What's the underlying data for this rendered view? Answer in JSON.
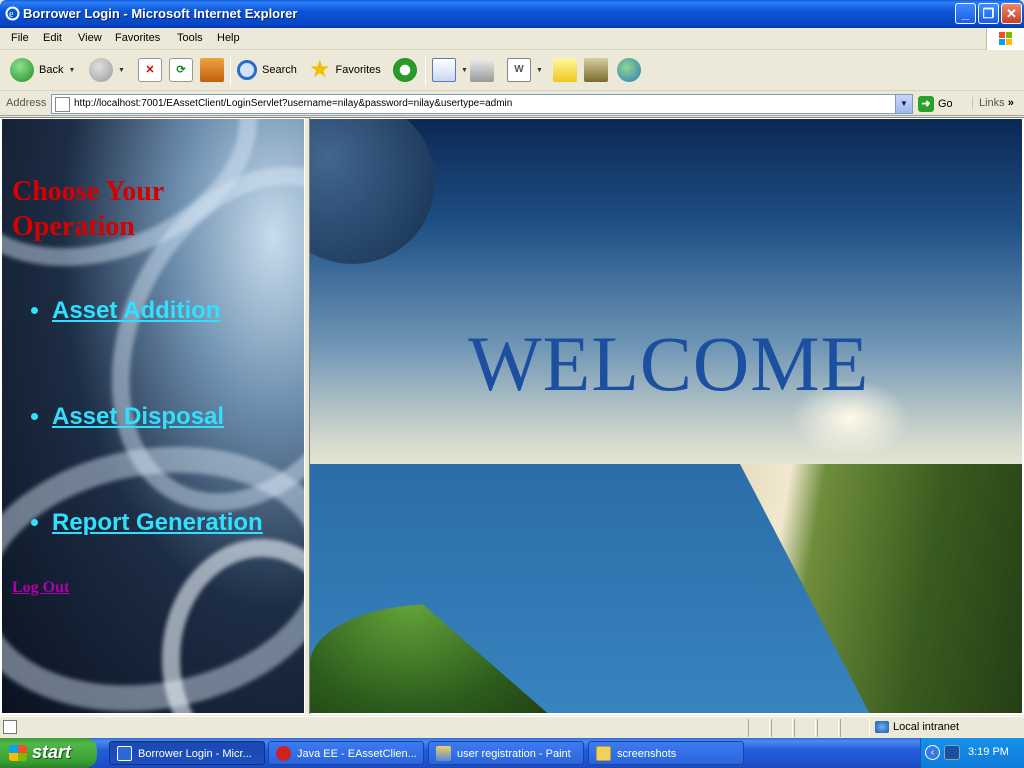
{
  "window": {
    "title": "Borrower Login - Microsoft Internet Explorer"
  },
  "menu": {
    "items": [
      "File",
      "Edit",
      "View",
      "Favorites",
      "Tools",
      "Help"
    ]
  },
  "toolbar": {
    "back": "Back",
    "search": "Search",
    "favorites": "Favorites"
  },
  "address": {
    "label": "Address",
    "url": "http://localhost:7001/EAssetClient/LoginServlet?username=nilay&password=nilay&usertype=admin",
    "go": "Go",
    "links": "Links"
  },
  "left": {
    "heading": "Choose Your Operation",
    "links": [
      "Asset Addition",
      "Asset Disposal",
      "Report Generation"
    ],
    "logout": "Log Out"
  },
  "right": {
    "welcome": "WELCOME"
  },
  "status": {
    "zone": "Local intranet"
  },
  "taskbar": {
    "start": "start",
    "tasks": [
      "Borrower Login - Micr...",
      "Java EE - EAssetClien...",
      "user registration - Paint",
      "screenshots"
    ],
    "clock": "3:19 PM"
  },
  "colors": {
    "heading": "#d50000",
    "link": "#31e0ff",
    "logout": "#b000b0",
    "welcome": "#1d4fa0"
  }
}
